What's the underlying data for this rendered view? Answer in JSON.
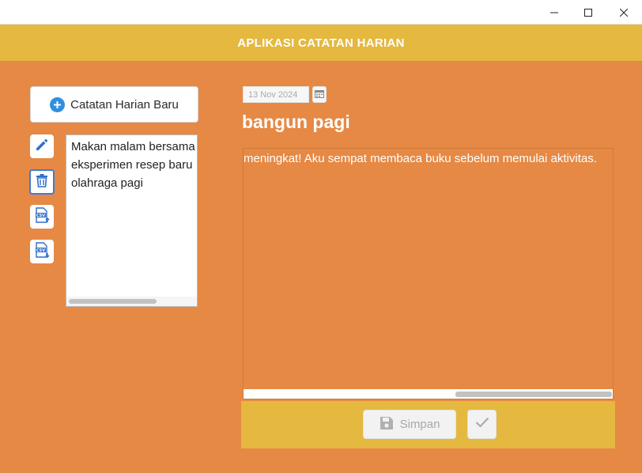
{
  "window": {
    "controls": [
      "minimize-icon",
      "maximize-icon",
      "close-icon"
    ]
  },
  "header": {
    "title": "APLIKASI CATATAN HARIAN"
  },
  "sidebar": {
    "new_button_label": "Catatan Harian Baru",
    "tools": [
      {
        "icon": "pencil-icon",
        "action": "edit"
      },
      {
        "icon": "trash-icon",
        "action": "delete"
      },
      {
        "icon": "csv-export-icon",
        "action": "export-csv"
      },
      {
        "icon": "csv-import-icon",
        "action": "import-csv"
      }
    ],
    "notes": [
      "Makan malam bersama",
      "eksperimen resep baru",
      "olahraga pagi"
    ]
  },
  "editor": {
    "date_value": "13 Nov 2024",
    "title": "bangun pagi",
    "content": "meningkat! Aku sempat membaca buku sebelum memulai aktivitas."
  },
  "footer": {
    "save_label": "Simpan"
  },
  "colors": {
    "background": "#e68944",
    "header": "#e5b83f",
    "accent_blue": "#2f8fe0"
  }
}
